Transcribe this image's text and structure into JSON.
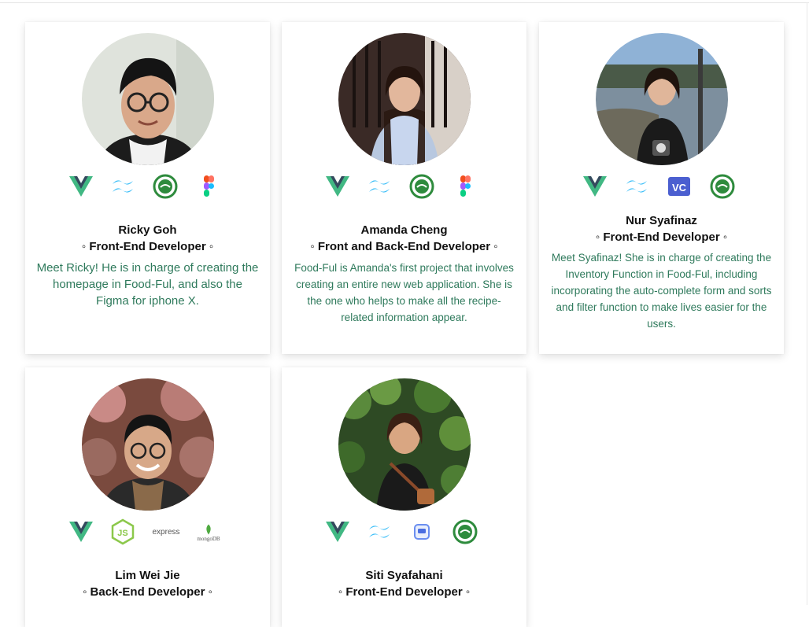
{
  "team": [
    {
      "name": "Ricky Goh",
      "role": "◦ Front-End Developer ◦",
      "description": "Meet Ricky! He is in charge of creating the homepage in Food-Ful, and also the Figma for iphone X.",
      "skills": [
        "vue-icon",
        "tailwind-icon",
        "foodful-logo-icon",
        "figma-icon"
      ]
    },
    {
      "name": "Amanda Cheng",
      "role": "◦ Front and Back-End Developer ◦",
      "description": "Food-Ful is Amanda's first project that involves creating an entire new web application. She is the one who helps to make all the recipe-related information appear.",
      "skills": [
        "vue-icon",
        "tailwind-icon",
        "foodful-logo-icon",
        "figma-icon"
      ]
    },
    {
      "name": "Nur Syafinaz",
      "role": "◦ Front-End Developer ◦",
      "description": "Meet Syafinaz! She is in charge of creating the Inventory Function in Food-Ful, including incorporating the auto-complete form and sorts and filter function to make lives easier for the users.",
      "skills": [
        "vue-icon",
        "tailwind-icon",
        "vc-icon",
        "foodful-logo-icon"
      ]
    },
    {
      "name": "Lim Wei Jie",
      "role": "◦ Back-End Developer ◦",
      "description": "",
      "skills": [
        "vue-icon",
        "nodejs-icon",
        "express-icon",
        "mongodb-icon"
      ],
      "skill_text": {
        "express": "express",
        "mongodb": "mongoDB"
      }
    },
    {
      "name": "Siti Syafahani",
      "role": "◦ Front-End Developer ◦",
      "description": "",
      "skills": [
        "vue-icon",
        "tailwind-icon",
        "app-window-icon",
        "foodful-logo-icon"
      ]
    }
  ],
  "colors": {
    "vue_green": "#41b883",
    "vue_dark": "#35495e",
    "tailwind": "#38bdf8",
    "foodful_green": "#2e8b3d",
    "description_text": "#2f7a5c",
    "nodejs": "#8cc84b",
    "mongodb": "#4faa41",
    "vc_blue": "#4b5fd0"
  }
}
